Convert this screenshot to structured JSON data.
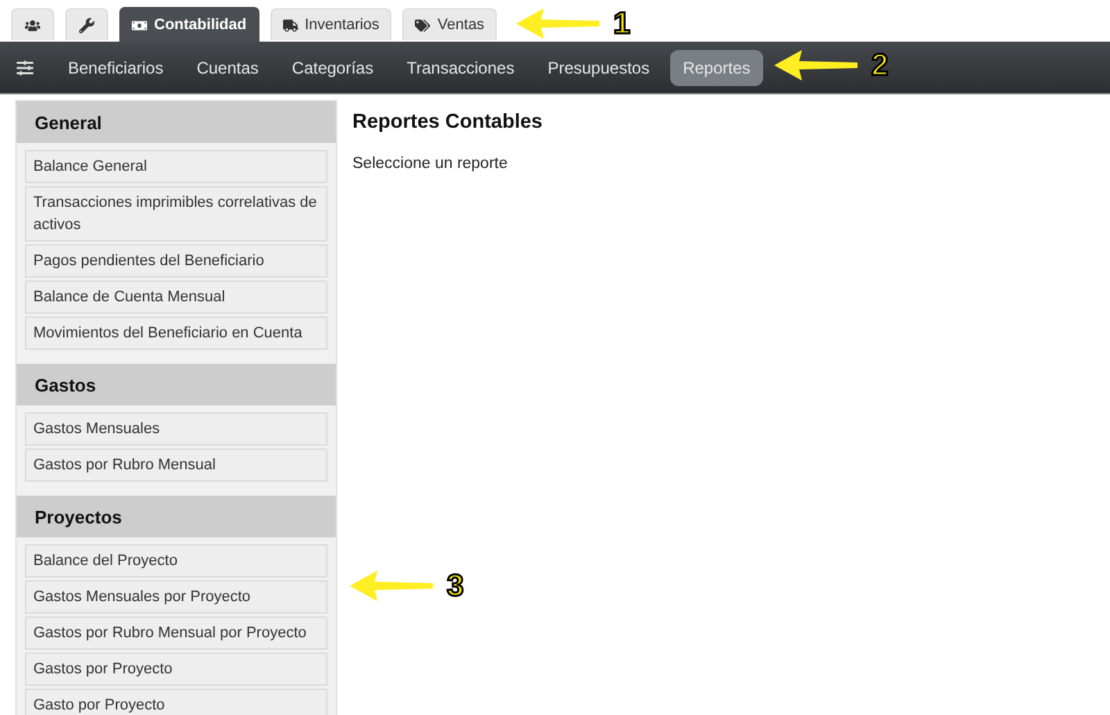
{
  "top_tabs": [
    {
      "kind": "icon",
      "selected": false
    },
    {
      "kind": "icon",
      "selected": false
    },
    {
      "kind": "text",
      "label": "Contabilidad",
      "selected": true
    },
    {
      "kind": "text",
      "label": "Inventarios",
      "selected": false
    },
    {
      "kind": "text",
      "label": "Ventas",
      "selected": false
    }
  ],
  "nav": {
    "items": [
      {
        "label": "Beneficiarios",
        "selected": false
      },
      {
        "label": "Cuentas",
        "selected": false
      },
      {
        "label": "Categorías",
        "selected": false
      },
      {
        "label": "Transacciones",
        "selected": false
      },
      {
        "label": "Presupuestos",
        "selected": false
      },
      {
        "label": "Reportes",
        "selected": true
      }
    ]
  },
  "sidebar": {
    "sections": [
      {
        "title": "General",
        "items": [
          "Balance General",
          "Transacciones imprimibles correlativas de activos",
          "Pagos pendientes del Beneficiario",
          "Balance de Cuenta Mensual",
          "Movimientos del Beneficiario en Cuenta"
        ]
      },
      {
        "title": "Gastos",
        "items": [
          "Gastos Mensuales",
          "Gastos por Rubro Mensual"
        ]
      },
      {
        "title": "Proyectos",
        "items": [
          "Balance del Proyecto",
          "Gastos Mensuales por Proyecto",
          "Gastos por Rubro Mensual por Proyecto",
          "Gastos por Proyecto",
          "Gasto por Proyecto"
        ]
      }
    ]
  },
  "main": {
    "title": "Reportes Contables",
    "message": "Seleccione un reporte"
  },
  "callouts": [
    {
      "number": "1"
    },
    {
      "number": "2"
    },
    {
      "number": "3"
    }
  ]
}
